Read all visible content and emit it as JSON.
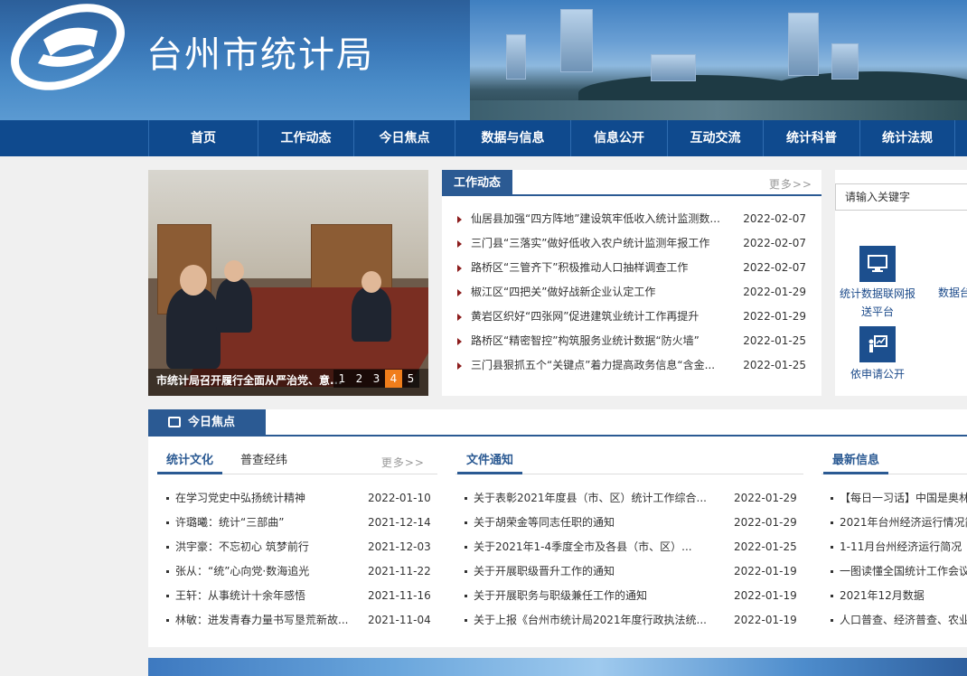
{
  "header": {
    "site_title": "台州市统计局"
  },
  "nav": {
    "items": [
      {
        "label": "首页"
      },
      {
        "label": "工作动态"
      },
      {
        "label": "今日焦点"
      },
      {
        "label": "数据与信息"
      },
      {
        "label": "信息公开"
      },
      {
        "label": "互动交流"
      },
      {
        "label": "统计科普"
      },
      {
        "label": "统计法规"
      }
    ]
  },
  "slideshow": {
    "caption": "市统计局召开履行全面从严治党、意...",
    "pages": [
      "1",
      "2",
      "3",
      "4",
      "5"
    ],
    "active_page": "4",
    "active_color": "#f07d1b"
  },
  "work_news": {
    "title": "工作动态",
    "more": "更多>>",
    "items": [
      {
        "title": "仙居县加强“四方阵地”建设筑牢低收入统计监测数...",
        "date": "2022-02-07"
      },
      {
        "title": "三门县“三落实”做好低收入农户统计监测年报工作",
        "date": "2022-02-07"
      },
      {
        "title": "路桥区“三管齐下”积极推动人口抽样调查工作",
        "date": "2022-02-07"
      },
      {
        "title": "椒江区“四把关”做好战新企业认定工作",
        "date": "2022-01-29"
      },
      {
        "title": "黄岩区织好“四张网”促进建筑业统计工作再提升",
        "date": "2022-01-29"
      },
      {
        "title": "路桥区“精密智控”构筑服务业统计数据“防火墙”",
        "date": "2022-01-25"
      },
      {
        "title": "三门县狠抓五个“关键点”着力提高政务信息“含金...",
        "date": "2022-01-25"
      }
    ]
  },
  "right_panel": {
    "search_placeholder": "请输入关键字",
    "services": [
      {
        "label": "统计数据联网报送平台",
        "icon": "monitor-icon"
      },
      {
        "label": "数据台",
        "icon": "data-icon"
      },
      {
        "label": "依申请公开",
        "icon": "chart-board-icon"
      }
    ]
  },
  "focus": {
    "title": "今日焦点",
    "culture": {
      "tab_active": "统计文化",
      "tab_other": "普查经纬",
      "more": "更多>>",
      "items": [
        {
          "title": "在学习党史中弘扬统计精神",
          "date": "2022-01-10"
        },
        {
          "title": "许璐曦：统计“三部曲”",
          "date": "2021-12-14"
        },
        {
          "title": "洪宇豪：不忘初心 筑梦前行",
          "date": "2021-12-03"
        },
        {
          "title": "张从：“统”心向党·数海追光",
          "date": "2021-11-22"
        },
        {
          "title": "王轩：从事统计十余年感悟",
          "date": "2021-11-16"
        },
        {
          "title": "林敏：迸发青春力量书写垦荒新故...",
          "date": "2021-11-04"
        }
      ]
    },
    "notices": {
      "title": "文件通知",
      "items": [
        {
          "title": "关于表彰2021年度县（市、区）统计工作综合...",
          "date": "2022-01-29"
        },
        {
          "title": "关于胡荣金等同志任职的通知",
          "date": "2022-01-29"
        },
        {
          "title": "关于2021年1-4季度全市及各县（市、区）...",
          "date": "2022-01-25"
        },
        {
          "title": "关于开展职级晋升工作的通知",
          "date": "2022-01-19"
        },
        {
          "title": "关于开展职务与职级兼任工作的通知",
          "date": "2022-01-19"
        },
        {
          "title": "关于上报《台州市统计局2021年度行政执法统...",
          "date": "2022-01-19"
        }
      ]
    },
    "latest": {
      "title": "最新信息",
      "items": [
        {
          "title": "【每日一习话】中国是奥林"
        },
        {
          "title": "2021年台州经济运行情况简"
        },
        {
          "title": "1-11月台州经济运行简况"
        },
        {
          "title": "一图读懂全国统计工作会议"
        },
        {
          "title": "2021年12月数据"
        },
        {
          "title": "人口普查、经济普查、农业"
        }
      ]
    }
  },
  "colors": {
    "nav_bg": "#0f4a8e",
    "accent": "#2b5a93",
    "bullet_arrow": "#8c1c1c"
  }
}
